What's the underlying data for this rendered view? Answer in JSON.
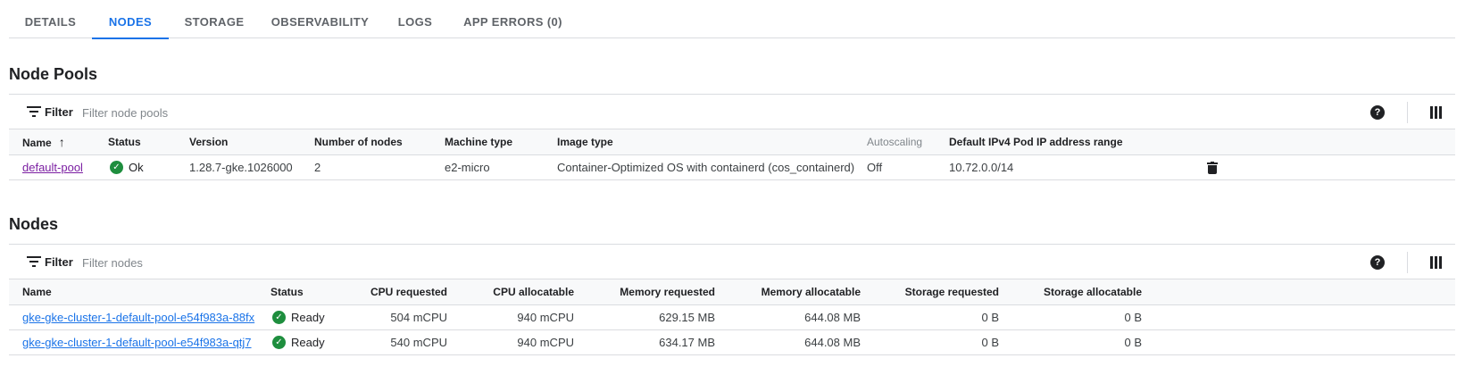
{
  "tabs": [
    {
      "label": "DETAILS"
    },
    {
      "label": "NODES"
    },
    {
      "label": "STORAGE"
    },
    {
      "label": "OBSERVABILITY"
    },
    {
      "label": "LOGS"
    },
    {
      "label": "APP ERRORS (0)"
    }
  ],
  "active_tab": "NODES",
  "node_pools": {
    "title": "Node Pools",
    "filter_label": "Filter",
    "filter_placeholder": "Filter node pools",
    "columns": [
      "Name",
      "Status",
      "Version",
      "Number of nodes",
      "Machine type",
      "Image type",
      "Autoscaling",
      "Default IPv4 Pod IP address range"
    ],
    "sort_column": "Name",
    "sort_direction": "ascending",
    "rows": [
      {
        "name": "default-pool",
        "status": "Ok",
        "version": "1.28.7-gke.1026000",
        "nodes": "2",
        "machine_type": "e2-micro",
        "image_type": "Container-Optimized OS with containerd (cos_containerd)",
        "autoscaling": "Off",
        "pod_ip_range": "10.72.0.0/14"
      }
    ]
  },
  "nodes": {
    "title": "Nodes",
    "filter_label": "Filter",
    "filter_placeholder": "Filter nodes",
    "columns": [
      "Name",
      "Status",
      "CPU requested",
      "CPU allocatable",
      "Memory requested",
      "Memory allocatable",
      "Storage requested",
      "Storage allocatable"
    ],
    "rows": [
      {
        "name": "gke-gke-cluster-1-default-pool-e54f983a-88fx",
        "status": "Ready",
        "cpu_requested": "504 mCPU",
        "cpu_allocatable": "940 mCPU",
        "mem_requested": "629.15 MB",
        "mem_allocatable": "644.08 MB",
        "storage_requested": "0 B",
        "storage_allocatable": "0 B"
      },
      {
        "name": "gke-gke-cluster-1-default-pool-e54f983a-qtj7",
        "status": "Ready",
        "cpu_requested": "540 mCPU",
        "cpu_allocatable": "940 mCPU",
        "mem_requested": "634.17 MB",
        "mem_allocatable": "644.08 MB",
        "storage_requested": "0 B",
        "storage_allocatable": "0 B"
      }
    ]
  },
  "icons": {
    "filter": "filter-icon",
    "help": "help-icon",
    "columns": "column-display-icon",
    "delete": "trash-icon",
    "status_ok": "check-circle-icon",
    "sort": "arrow-up-icon"
  },
  "colors": {
    "accent": "#1a73e8",
    "visited_link": "#7b1fa2",
    "status_ok": "#1e8e3e"
  }
}
